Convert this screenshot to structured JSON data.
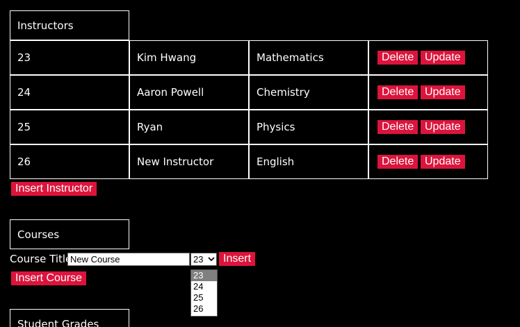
{
  "instructors": {
    "heading": "Instructors",
    "rows": [
      {
        "id": "23",
        "name": "Kim Hwang",
        "subject": "Mathematics"
      },
      {
        "id": "24",
        "name": "Aaron Powell",
        "subject": "Chemistry"
      },
      {
        "id": "25",
        "name": "Ryan",
        "subject": "Physics"
      },
      {
        "id": "26",
        "name": "New Instructor",
        "subject": "English"
      }
    ],
    "delete_label": "Delete",
    "update_label": "Update",
    "insert_label": "Insert Instructor"
  },
  "courses": {
    "heading": "Courses",
    "title_label": "Course Title",
    "title_value": "New Course",
    "instructor_selected": "23",
    "instructor_options": [
      "23",
      "24",
      "25",
      "26"
    ],
    "insert_label": "Insert",
    "insert_course_label": "Insert Course"
  },
  "grades": {
    "heading": "Student Grades"
  },
  "icons": {
    "select_chevron": "chevron-down-icon"
  },
  "colors": {
    "background": "#000000",
    "button": "#dc143c",
    "text": "#ffffff"
  }
}
